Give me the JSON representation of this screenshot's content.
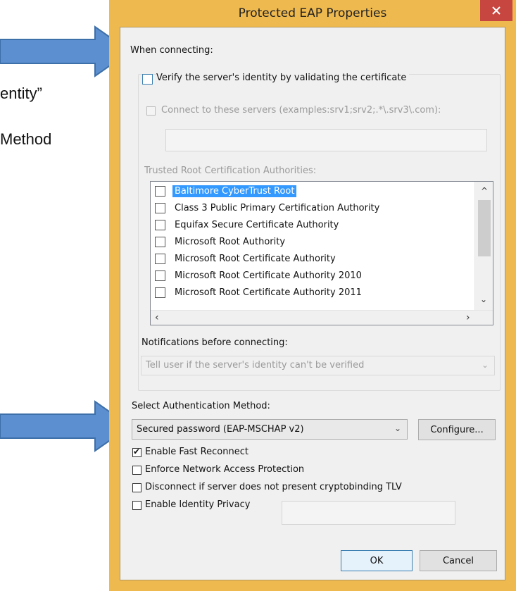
{
  "background": {
    "text_identity": "entity”",
    "text_method": "Method"
  },
  "dialog": {
    "title": "Protected EAP Properties",
    "close_icon": "close-icon"
  },
  "when_connecting": {
    "label": "When connecting:",
    "verify_label": "Verify the server's identity by validating the certificate",
    "verify_checked": false,
    "connect_servers_label": "Connect to these servers (examples:srv1;srv2;.*\\.srv3\\.com):",
    "connect_servers_value": "",
    "trusted_root_label": "Trusted Root Certification Authorities:",
    "certificates": [
      {
        "label": "Baltimore CyberTrust Root",
        "checked": false,
        "selected": true
      },
      {
        "label": "Class 3 Public Primary Certification Authority",
        "checked": false,
        "selected": false
      },
      {
        "label": "Equifax Secure Certificate Authority",
        "checked": false,
        "selected": false
      },
      {
        "label": "Microsoft Root Authority",
        "checked": false,
        "selected": false
      },
      {
        "label": "Microsoft Root Certificate Authority",
        "checked": false,
        "selected": false
      },
      {
        "label": "Microsoft Root Certificate Authority 2010",
        "checked": false,
        "selected": false
      },
      {
        "label": "Microsoft Root Certificate Authority 2011",
        "checked": false,
        "selected": false
      }
    ],
    "notifications_label": "Notifications before connecting:",
    "notifications_value": "Tell user if the server's identity can't be verified"
  },
  "auth": {
    "label": "Select Authentication Method:",
    "value": "Secured password (EAP-MSCHAP v2)",
    "configure_label": "Configure...",
    "options": [
      {
        "label": "Enable Fast Reconnect",
        "checked": true
      },
      {
        "label": "Enforce Network Access Protection",
        "checked": false
      },
      {
        "label": "Disconnect if server does not present cryptobinding TLV",
        "checked": false
      },
      {
        "label": "Enable Identity Privacy",
        "checked": false
      }
    ],
    "identity_privacy_value": ""
  },
  "buttons": {
    "ok": "OK",
    "cancel": "Cancel"
  },
  "colors": {
    "title_bar": "#eeb94f",
    "close_button": "#c7463f",
    "arrow_fill": "#5b8fd0",
    "arrow_stroke": "#3d6fa8",
    "selection": "#3399ff"
  }
}
